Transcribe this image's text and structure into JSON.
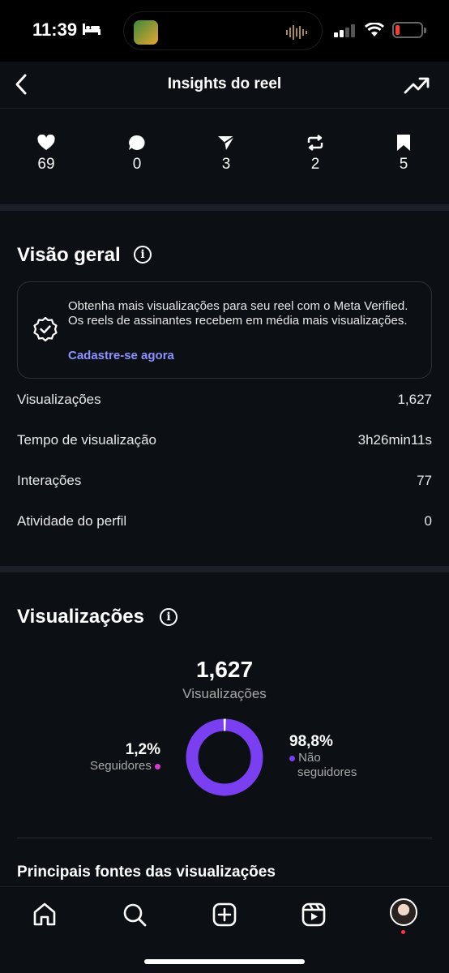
{
  "status_bar": {
    "time": "11:39"
  },
  "header": {
    "title": "Insights do reel"
  },
  "metrics": [
    {
      "icon": "heart-icon",
      "value": "69"
    },
    {
      "icon": "comment-icon",
      "value": "0"
    },
    {
      "icon": "share-icon",
      "value": "3"
    },
    {
      "icon": "repost-icon",
      "value": "2"
    },
    {
      "icon": "bookmark-icon",
      "value": "5"
    }
  ],
  "overview": {
    "title": "Visão geral",
    "promo_text": "Obtenha mais visualizações para seu reel com o Meta Verified. Os reels de assinantes recebem em média mais visualizações.",
    "promo_link": "Cadastre-se agora",
    "stats": [
      {
        "label": "Visualizações",
        "value": "1,627"
      },
      {
        "label": "Tempo de visualização",
        "value": "3h26min11s"
      },
      {
        "label": "Interações",
        "value": "77"
      },
      {
        "label": "Atividade do perfil",
        "value": "0"
      }
    ]
  },
  "views": {
    "title": "Visualizações",
    "total": "1,627",
    "total_label": "Visualizações",
    "followers_pct": "1,2%",
    "followers_label": "Seguidores",
    "non_followers_pct": "98,8%",
    "non_followers_label_1": "Não",
    "non_followers_label_2": "seguidores",
    "followers_fraction": 0.012,
    "colors": {
      "followers": "#d63ad0",
      "non_followers": "#7b3ff2"
    }
  },
  "sources": {
    "title": "Principais fontes das visualizações"
  },
  "colors": {
    "background": "#0c0f14",
    "link": "#8e92ff"
  }
}
